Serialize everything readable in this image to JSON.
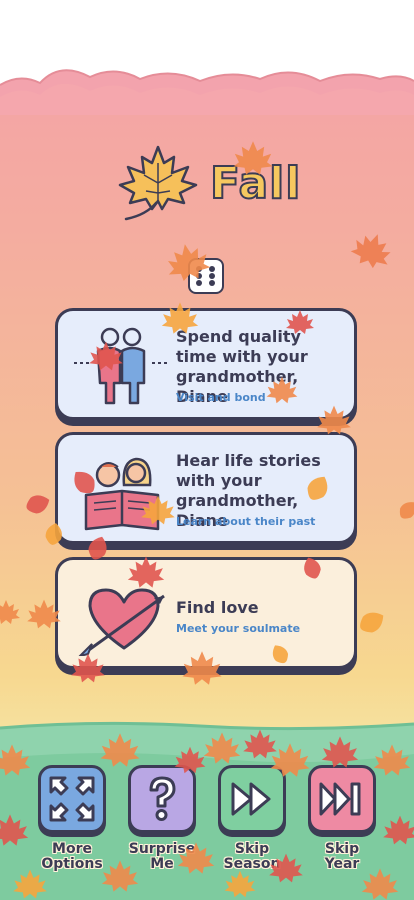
{
  "header": {
    "season_title": "Fall"
  },
  "cards": [
    {
      "title": "Spend quality time with your grandmother, Diane",
      "subtitle": "Visit and bond"
    },
    {
      "title": "Hear life stories with your grandmother, Diane",
      "subtitle": "Learn about their past"
    },
    {
      "title": "Find love",
      "subtitle": "Meet your soulmate"
    }
  ],
  "bottom_bar": {
    "more_options": "More Options",
    "surprise_me": "Surprise Me",
    "skip_season": "Skip Season",
    "skip_year": "Skip Year"
  },
  "colors": {
    "ink": "#3c3c55",
    "accent_blue": "#4a86c8",
    "leaf_orange": "#f08a4b",
    "leaf_red": "#e0554e",
    "title_yellow": "#f6c85f"
  },
  "icons": [
    "maple-leaf-icon",
    "dice-icon",
    "expand-arrows-icon",
    "question-mark-icon",
    "fast-forward-icon",
    "skip-forward-icon"
  ]
}
